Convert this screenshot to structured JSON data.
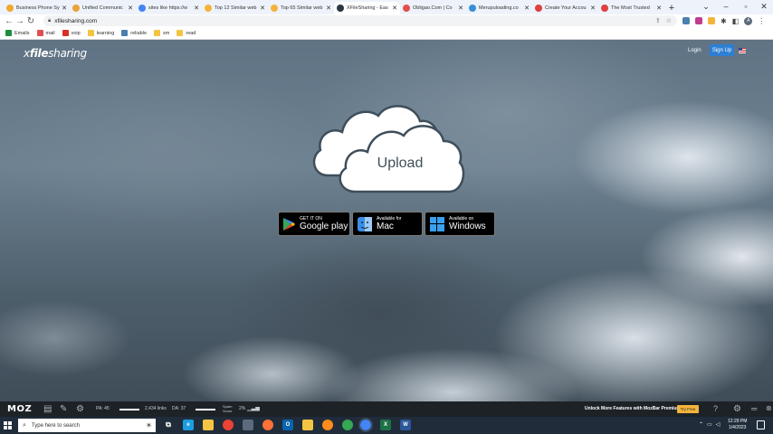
{
  "browser": {
    "tabs": [
      {
        "label": "Business Phone Sy",
        "color": "#f0a830",
        "active": false
      },
      {
        "label": "Unified Communic",
        "color": "#e8a33c",
        "active": false
      },
      {
        "label": "sites like https://w",
        "color": "#4285f4",
        "active": false
      },
      {
        "label": "Top 12 Similar web",
        "color": "#f4b43c",
        "active": false
      },
      {
        "label": "Top 65 Similar web",
        "color": "#f4b43c",
        "active": false
      },
      {
        "label": "XFileSharing - Eas",
        "color": "#2b3642",
        "active": true
      },
      {
        "label": "Obligao.Com | Co",
        "color": "#e05050",
        "active": false
      },
      {
        "label": "Merupuloading.co",
        "color": "#3b8ed6",
        "active": false
      },
      {
        "label": "Create Your Accou",
        "color": "#e04040",
        "active": false
      },
      {
        "label": "The Most Trusted",
        "color": "#e04040",
        "active": false
      }
    ],
    "new_tab": "+",
    "url": "xfilesharing.com",
    "bookmarks": [
      {
        "label": "Emails",
        "color": "#1e8e3e"
      },
      {
        "label": "mail",
        "color": "#e05050"
      },
      {
        "label": "voip",
        "color": "#d93025"
      },
      {
        "label": "learning",
        "color": "#f4c542"
      },
      {
        "label": "reliable",
        "color": "#4a7fb0"
      },
      {
        "label": "sm",
        "color": "#f4c542"
      },
      {
        "label": "read",
        "color": "#f4c542"
      }
    ],
    "profile_initial": "A"
  },
  "site": {
    "logo_prefix": "x",
    "logo_bold": "file",
    "logo_suffix": "sharing",
    "login": "Login",
    "signup": "Sign Up",
    "upload": "Upload",
    "google_play": {
      "small": "GET IT ON",
      "big": "Google play"
    },
    "mac": {
      "small": "Available for",
      "big": "Mac"
    },
    "windows": {
      "small": "Available on",
      "big": "Windows"
    }
  },
  "mozbar": {
    "logo": "MOZ",
    "pa": "PA: 45",
    "links": "2,434 links",
    "da": "DA: 37",
    "spam_score": "Spam\nScore",
    "spam_value": "2%",
    "premium": "Unlock More Features with MozBar Premium",
    "try_free": "Try Free"
  },
  "taskbar": {
    "search_placeholder": "Type here to search",
    "time": "12:29 PM",
    "date": "1/4/2023"
  }
}
